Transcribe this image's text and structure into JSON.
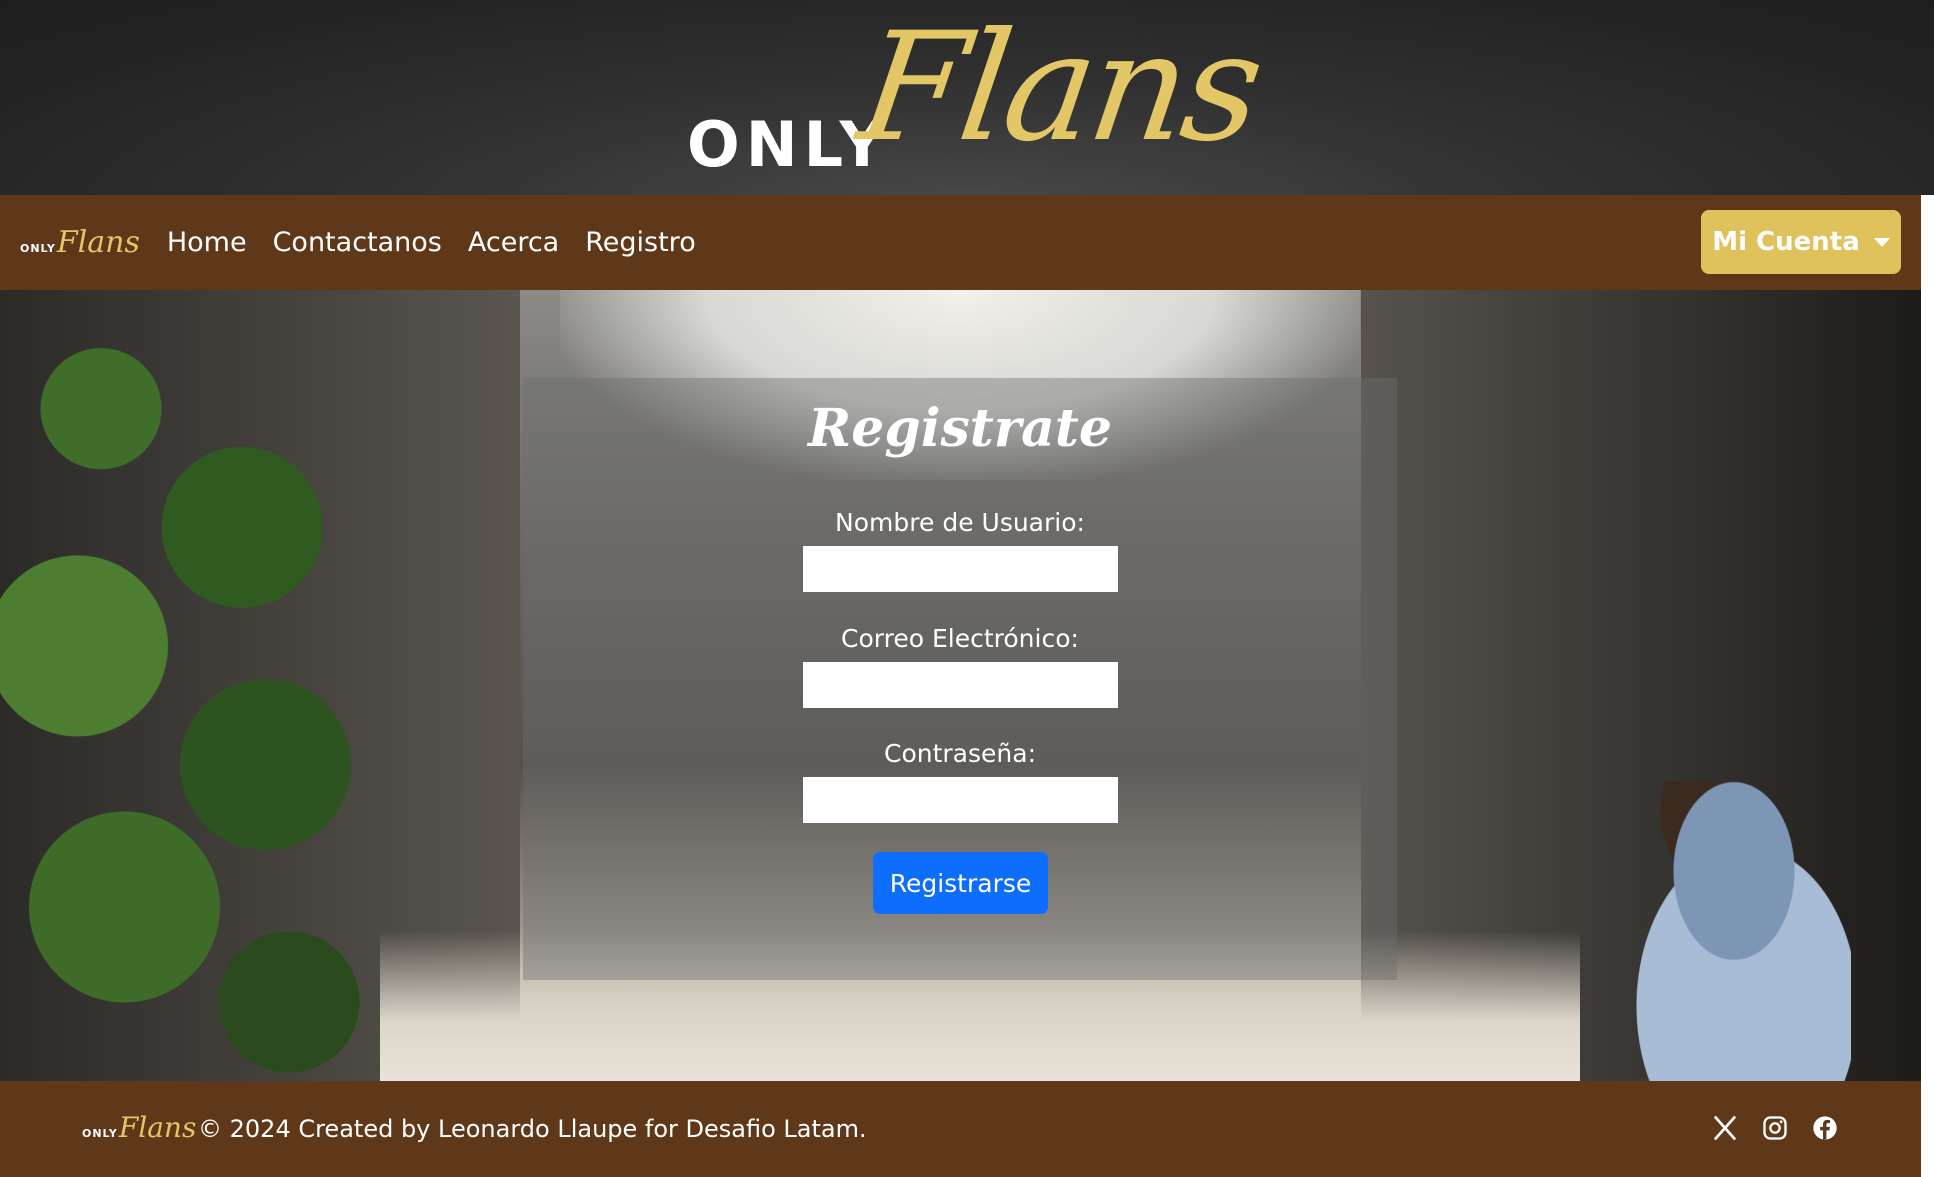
{
  "banner": {
    "logo_prefix": "ONLY",
    "logo_word": "Flans"
  },
  "navbar": {
    "brand_prefix": "ONLY",
    "brand_word": "Flans",
    "links": [
      "Home",
      "Contactanos",
      "Acerca",
      "Registro"
    ],
    "account_button": "Mi Cuenta"
  },
  "form": {
    "title": "Registrate",
    "fields": [
      {
        "label": "Nombre de Usuario:",
        "value": ""
      },
      {
        "label": "Correo Electrónico:",
        "value": ""
      },
      {
        "label": "Contraseña:",
        "value": ""
      }
    ],
    "submit_label": "Registrarse"
  },
  "footer": {
    "brand_prefix": "ONLY",
    "brand_word": "Flans",
    "text": "© 2024 Created by Leonardo Llaupe for Desafio Latam.",
    "social_icons": [
      "x-icon",
      "instagram-icon",
      "facebook-icon"
    ]
  },
  "colors": {
    "banner_bg": "#2b2b2b",
    "nav_bg": "#5e3819",
    "brand_gold": "#e3c766",
    "account_button_bg": "#dfc25b",
    "submit_bg": "#0d6efd"
  }
}
